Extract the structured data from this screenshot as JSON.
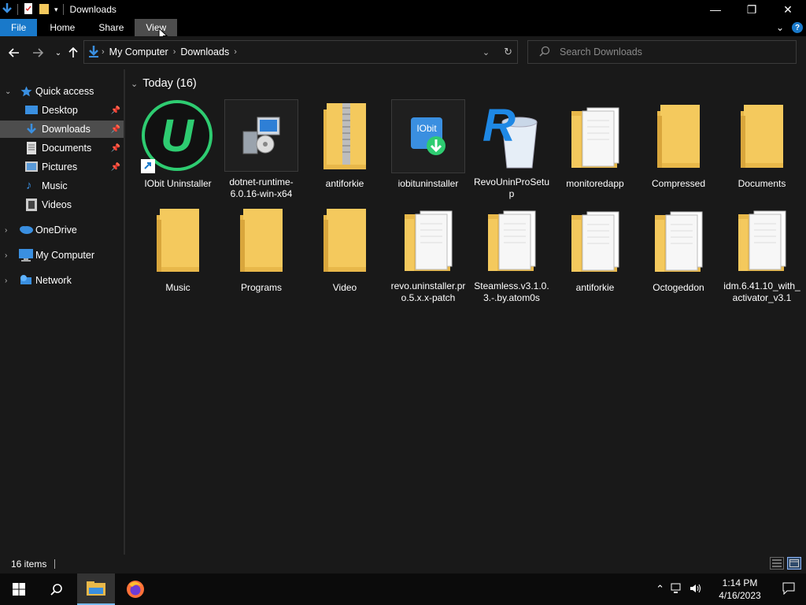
{
  "window": {
    "title": "Downloads",
    "controls": {
      "minimize": "—",
      "maximize": "❐",
      "close": "✕"
    }
  },
  "ribbon": {
    "tabs": [
      {
        "label": "File"
      },
      {
        "label": "Home"
      },
      {
        "label": "Share"
      },
      {
        "label": "View"
      }
    ],
    "help": "?"
  },
  "navigation": {
    "breadcrumb": [
      "My Computer",
      "Downloads"
    ],
    "search_placeholder": "Search Downloads"
  },
  "sidebar": {
    "quick_access": "Quick access",
    "quick_items": [
      {
        "label": "Desktop",
        "pinned": true
      },
      {
        "label": "Downloads",
        "pinned": true,
        "selected": true
      },
      {
        "label": "Documents",
        "pinned": true
      },
      {
        "label": "Pictures",
        "pinned": true
      },
      {
        "label": "Music",
        "pinned": false
      },
      {
        "label": "Videos",
        "pinned": false
      }
    ],
    "roots": [
      "OneDrive",
      "My Computer",
      "Network"
    ]
  },
  "content": {
    "group_title": "Today (16)",
    "items": [
      {
        "label": "IObit Uninstaller",
        "icon": "iobit-shortcut-icon"
      },
      {
        "label": "dotnet-runtime-6.0.16-win-x64",
        "icon": "installer-icon"
      },
      {
        "label": "antiforkie",
        "icon": "zip-folder-icon"
      },
      {
        "label": "iobituninstaller",
        "icon": "iobit-installer-icon"
      },
      {
        "label": "RevoUninProSetup",
        "icon": "revo-icon"
      },
      {
        "label": "monitoredapp",
        "icon": "folder-with-files-icon"
      },
      {
        "label": "Compressed",
        "icon": "folder-icon"
      },
      {
        "label": "Documents",
        "icon": "folder-icon"
      },
      {
        "label": "Music",
        "icon": "folder-icon"
      },
      {
        "label": "Programs",
        "icon": "folder-icon"
      },
      {
        "label": "Video",
        "icon": "folder-icon"
      },
      {
        "label": "revo.uninstaller.pro.5.x.x-patch",
        "icon": "folder-with-files-icon"
      },
      {
        "label": "Steamless.v3.1.0.3.-.by.atom0s",
        "icon": "folder-with-files-icon"
      },
      {
        "label": "antiforkie",
        "icon": "folder-with-files-icon"
      },
      {
        "label": "Octogeddon",
        "icon": "folder-with-files-icon"
      },
      {
        "label": "idm.6.41.10_with_activator_v3.1",
        "icon": "folder-with-files-icon"
      }
    ]
  },
  "status": {
    "count": "16 items"
  },
  "taskbar": {
    "time": "1:14 PM",
    "date": "4/16/2023"
  },
  "colors": {
    "accent": "#1979ca",
    "folder": "#f4c95d",
    "background": "#191919"
  }
}
